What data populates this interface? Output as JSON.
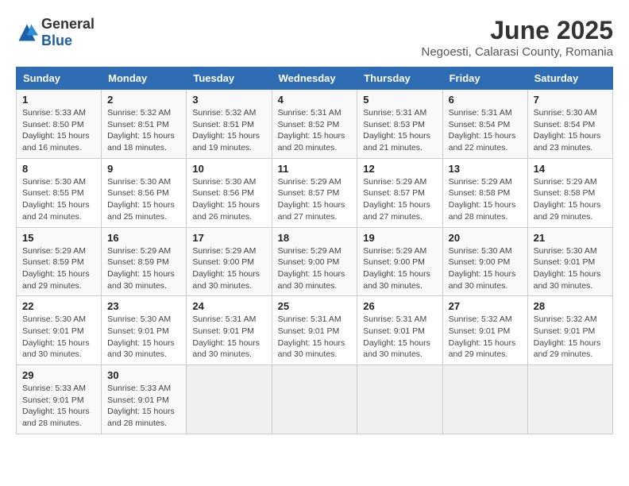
{
  "logo": {
    "general": "General",
    "blue": "Blue"
  },
  "title": "June 2025",
  "subtitle": "Negoesti, Calarasi County, Romania",
  "header_days": [
    "Sunday",
    "Monday",
    "Tuesday",
    "Wednesday",
    "Thursday",
    "Friday",
    "Saturday"
  ],
  "weeks": [
    [
      {
        "day": "1",
        "sunrise": "Sunrise: 5:33 AM",
        "sunset": "Sunset: 8:50 PM",
        "daylight": "Daylight: 15 hours and 16 minutes."
      },
      {
        "day": "2",
        "sunrise": "Sunrise: 5:32 AM",
        "sunset": "Sunset: 8:51 PM",
        "daylight": "Daylight: 15 hours and 18 minutes."
      },
      {
        "day": "3",
        "sunrise": "Sunrise: 5:32 AM",
        "sunset": "Sunset: 8:51 PM",
        "daylight": "Daylight: 15 hours and 19 minutes."
      },
      {
        "day": "4",
        "sunrise": "Sunrise: 5:31 AM",
        "sunset": "Sunset: 8:52 PM",
        "daylight": "Daylight: 15 hours and 20 minutes."
      },
      {
        "day": "5",
        "sunrise": "Sunrise: 5:31 AM",
        "sunset": "Sunset: 8:53 PM",
        "daylight": "Daylight: 15 hours and 21 minutes."
      },
      {
        "day": "6",
        "sunrise": "Sunrise: 5:31 AM",
        "sunset": "Sunset: 8:54 PM",
        "daylight": "Daylight: 15 hours and 22 minutes."
      },
      {
        "day": "7",
        "sunrise": "Sunrise: 5:30 AM",
        "sunset": "Sunset: 8:54 PM",
        "daylight": "Daylight: 15 hours and 23 minutes."
      }
    ],
    [
      {
        "day": "8",
        "sunrise": "Sunrise: 5:30 AM",
        "sunset": "Sunset: 8:55 PM",
        "daylight": "Daylight: 15 hours and 24 minutes."
      },
      {
        "day": "9",
        "sunrise": "Sunrise: 5:30 AM",
        "sunset": "Sunset: 8:56 PM",
        "daylight": "Daylight: 15 hours and 25 minutes."
      },
      {
        "day": "10",
        "sunrise": "Sunrise: 5:30 AM",
        "sunset": "Sunset: 8:56 PM",
        "daylight": "Daylight: 15 hours and 26 minutes."
      },
      {
        "day": "11",
        "sunrise": "Sunrise: 5:29 AM",
        "sunset": "Sunset: 8:57 PM",
        "daylight": "Daylight: 15 hours and 27 minutes."
      },
      {
        "day": "12",
        "sunrise": "Sunrise: 5:29 AM",
        "sunset": "Sunset: 8:57 PM",
        "daylight": "Daylight: 15 hours and 27 minutes."
      },
      {
        "day": "13",
        "sunrise": "Sunrise: 5:29 AM",
        "sunset": "Sunset: 8:58 PM",
        "daylight": "Daylight: 15 hours and 28 minutes."
      },
      {
        "day": "14",
        "sunrise": "Sunrise: 5:29 AM",
        "sunset": "Sunset: 8:58 PM",
        "daylight": "Daylight: 15 hours and 29 minutes."
      }
    ],
    [
      {
        "day": "15",
        "sunrise": "Sunrise: 5:29 AM",
        "sunset": "Sunset: 8:59 PM",
        "daylight": "Daylight: 15 hours and 29 minutes."
      },
      {
        "day": "16",
        "sunrise": "Sunrise: 5:29 AM",
        "sunset": "Sunset: 8:59 PM",
        "daylight": "Daylight: 15 hours and 30 minutes."
      },
      {
        "day": "17",
        "sunrise": "Sunrise: 5:29 AM",
        "sunset": "Sunset: 9:00 PM",
        "daylight": "Daylight: 15 hours and 30 minutes."
      },
      {
        "day": "18",
        "sunrise": "Sunrise: 5:29 AM",
        "sunset": "Sunset: 9:00 PM",
        "daylight": "Daylight: 15 hours and 30 minutes."
      },
      {
        "day": "19",
        "sunrise": "Sunrise: 5:29 AM",
        "sunset": "Sunset: 9:00 PM",
        "daylight": "Daylight: 15 hours and 30 minutes."
      },
      {
        "day": "20",
        "sunrise": "Sunrise: 5:30 AM",
        "sunset": "Sunset: 9:00 PM",
        "daylight": "Daylight: 15 hours and 30 minutes."
      },
      {
        "day": "21",
        "sunrise": "Sunrise: 5:30 AM",
        "sunset": "Sunset: 9:01 PM",
        "daylight": "Daylight: 15 hours and 30 minutes."
      }
    ],
    [
      {
        "day": "22",
        "sunrise": "Sunrise: 5:30 AM",
        "sunset": "Sunset: 9:01 PM",
        "daylight": "Daylight: 15 hours and 30 minutes."
      },
      {
        "day": "23",
        "sunrise": "Sunrise: 5:30 AM",
        "sunset": "Sunset: 9:01 PM",
        "daylight": "Daylight: 15 hours and 30 minutes."
      },
      {
        "day": "24",
        "sunrise": "Sunrise: 5:31 AM",
        "sunset": "Sunset: 9:01 PM",
        "daylight": "Daylight: 15 hours and 30 minutes."
      },
      {
        "day": "25",
        "sunrise": "Sunrise: 5:31 AM",
        "sunset": "Sunset: 9:01 PM",
        "daylight": "Daylight: 15 hours and 30 minutes."
      },
      {
        "day": "26",
        "sunrise": "Sunrise: 5:31 AM",
        "sunset": "Sunset: 9:01 PM",
        "daylight": "Daylight: 15 hours and 30 minutes."
      },
      {
        "day": "27",
        "sunrise": "Sunrise: 5:32 AM",
        "sunset": "Sunset: 9:01 PM",
        "daylight": "Daylight: 15 hours and 29 minutes."
      },
      {
        "day": "28",
        "sunrise": "Sunrise: 5:32 AM",
        "sunset": "Sunset: 9:01 PM",
        "daylight": "Daylight: 15 hours and 29 minutes."
      }
    ],
    [
      {
        "day": "29",
        "sunrise": "Sunrise: 5:33 AM",
        "sunset": "Sunset: 9:01 PM",
        "daylight": "Daylight: 15 hours and 28 minutes."
      },
      {
        "day": "30",
        "sunrise": "Sunrise: 5:33 AM",
        "sunset": "Sunset: 9:01 PM",
        "daylight": "Daylight: 15 hours and 28 minutes."
      },
      null,
      null,
      null,
      null,
      null
    ]
  ]
}
